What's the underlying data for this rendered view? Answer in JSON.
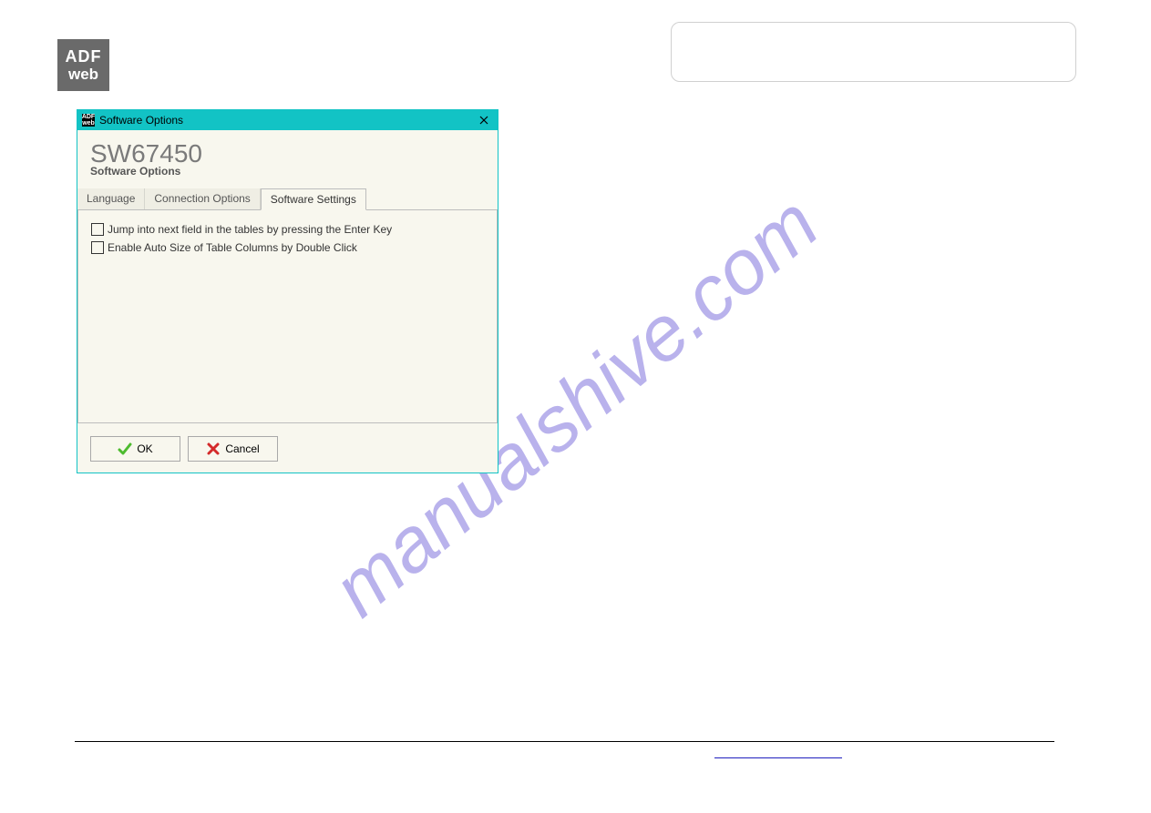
{
  "logo": {
    "line1": "ADF",
    "line2": "web"
  },
  "watermark": "manualshive.com",
  "dialog": {
    "title": "Software Options",
    "header_title": "SW67450",
    "header_sub": "Software Options",
    "tabs": [
      {
        "label": "Language",
        "active": false
      },
      {
        "label": "Connection Options",
        "active": false
      },
      {
        "label": "Software Settings",
        "active": true
      }
    ],
    "options": [
      {
        "label": "Jump into next field in the tables by pressing the Enter Key",
        "checked": false
      },
      {
        "label": "Enable Auto Size of Table Columns by Double Click",
        "checked": false
      }
    ],
    "buttons": {
      "ok": "OK",
      "cancel": "Cancel"
    }
  }
}
